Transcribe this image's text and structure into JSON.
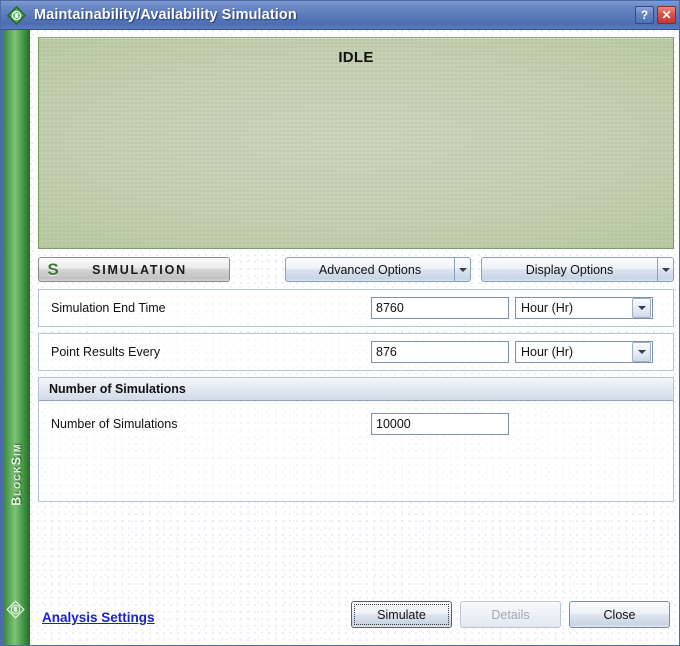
{
  "window": {
    "title": "Maintainability/Availability Simulation",
    "app_icon": "blocksim-diamond-icon",
    "help_label": "?",
    "close_label": "✕"
  },
  "sidebar": {
    "product_label": "BlockSim",
    "logo_icon": "blocksim-hexagon-b-icon"
  },
  "status_panel": {
    "state_text": "IDLE"
  },
  "simulation_header": {
    "badge_logo": "S",
    "badge_label": "SIMULATION",
    "advanced_options_label": "Advanced Options",
    "advanced_options_arrow_icon": "chevron-down-icon",
    "display_options_label": "Display Options",
    "display_options_arrow_icon": "chevron-down-icon"
  },
  "form": {
    "rows": [
      {
        "label": "Simulation End Time",
        "value": "8760",
        "unit": "Hour (Hr)",
        "unit_arrow_icon": "chevron-down-icon"
      },
      {
        "label": "Point Results Every",
        "value": "876",
        "unit": "Hour (Hr)",
        "unit_arrow_icon": "chevron-down-icon"
      }
    ]
  },
  "group_number_of_simulations": {
    "header_title": "Number of Simulations",
    "row_label": "Number of Simulations",
    "row_value": "10000"
  },
  "footer": {
    "analysis_settings_label": "Analysis Settings",
    "simulate_label": "Simulate",
    "details_label": "Details",
    "close_label": "Close"
  },
  "colors": {
    "titlebar_blue": "#5878b8",
    "sidebar_green": "#59a855",
    "idle_panel_green": "#c6d0b4",
    "link_blue": "#1a22cc",
    "logo_green": "#3f7a3a",
    "close_button_red": "#d9534a"
  }
}
